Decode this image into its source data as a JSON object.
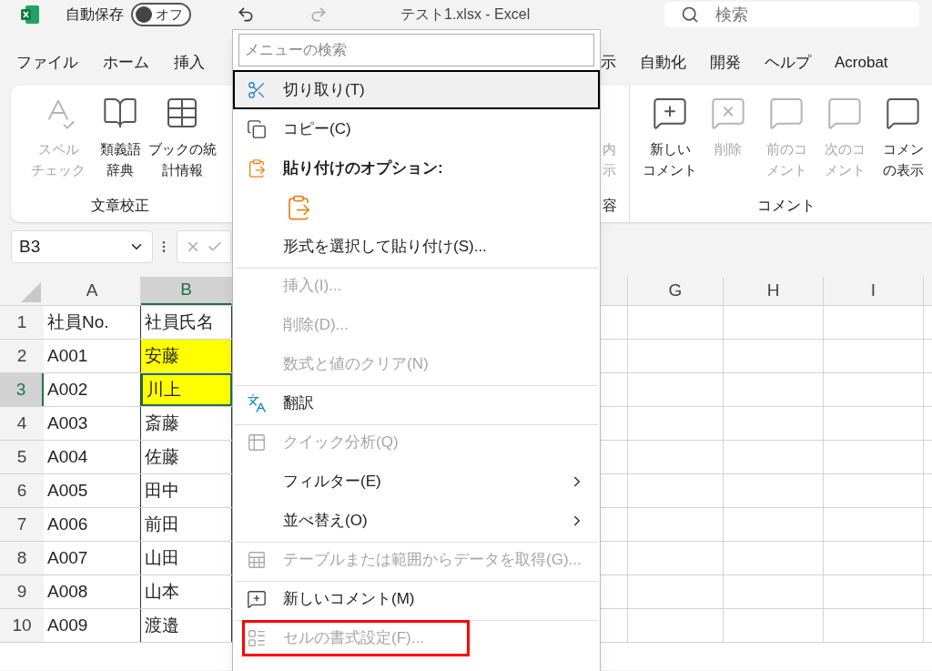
{
  "title_bar": {
    "autosave": {
      "label": "自動保存",
      "on": false,
      "state_label": "オフ"
    },
    "title": "テスト1.xlsx - Excel",
    "search": {
      "placeholder": "検索"
    }
  },
  "ribbon_tabs": {
    "left": [
      {
        "label": "ファイル"
      },
      {
        "label": "ホーム"
      },
      {
        "label": "挿入"
      }
    ],
    "right": [
      {
        "label": "示"
      },
      {
        "label": "自動化"
      },
      {
        "label": "開発"
      },
      {
        "label": "ヘルプ"
      },
      {
        "label": "Acrobat"
      }
    ]
  },
  "ribbon": {
    "left_groups": [
      {
        "label": "文章校正",
        "buttons": [
          {
            "lines": [
              "スペル",
              "チェック"
            ],
            "disabled": true
          },
          {
            "lines": [
              "類義語",
              "辞典"
            ],
            "disabled": false
          },
          {
            "lines": [
              "ブックの統",
              "計情報"
            ],
            "disabled": false
          }
        ]
      }
    ],
    "right_groups": [
      {
        "label": "容",
        "buttons": [
          {
            "lines": [
              "内",
              "示"
            ],
            "disabled": true
          }
        ]
      },
      {
        "label": "コメント",
        "buttons": [
          {
            "lines": [
              "新しい",
              "コメント"
            ],
            "disabled": false
          },
          {
            "lines": [
              "削除"
            ],
            "disabled": true
          },
          {
            "lines": [
              "前のコ",
              "メント"
            ],
            "disabled": true
          },
          {
            "lines": [
              "次のコ",
              "メント"
            ],
            "disabled": true
          },
          {
            "lines": [
              "コメン",
              "の表示"
            ],
            "disabled": false
          }
        ]
      }
    ]
  },
  "formula_bar": {
    "name_box": "B3"
  },
  "sheet": {
    "left_columns": [
      {
        "label": "A",
        "selected": false
      },
      {
        "label": "B",
        "selected": true
      }
    ],
    "right_columns": [
      {
        "label": "G",
        "selected": false
      },
      {
        "label": "H",
        "selected": false
      },
      {
        "label": "I",
        "selected": false
      }
    ],
    "rows": [
      {
        "number": "1",
        "selected": false,
        "cells": [
          {
            "value": "社員No.",
            "highlighted": false,
            "active": false
          },
          {
            "value": "社員氏名",
            "highlighted": false,
            "active": false
          }
        ]
      },
      {
        "number": "2",
        "selected": false,
        "cells": [
          {
            "value": "A001",
            "highlighted": false,
            "active": false
          },
          {
            "value": "安藤",
            "highlighted": true,
            "active": false
          }
        ]
      },
      {
        "number": "3",
        "selected": true,
        "cells": [
          {
            "value": "A002",
            "highlighted": false,
            "active": false
          },
          {
            "value": "川上",
            "highlighted": true,
            "active": true
          }
        ]
      },
      {
        "number": "4",
        "selected": false,
        "cells": [
          {
            "value": "A003",
            "highlighted": false,
            "active": false
          },
          {
            "value": "斎藤",
            "highlighted": false,
            "active": false
          }
        ]
      },
      {
        "number": "5",
        "selected": false,
        "cells": [
          {
            "value": "A004",
            "highlighted": false,
            "active": false
          },
          {
            "value": "佐藤",
            "highlighted": false,
            "active": false
          }
        ]
      },
      {
        "number": "6",
        "selected": false,
        "cells": [
          {
            "value": "A005",
            "highlighted": false,
            "active": false
          },
          {
            "value": "田中",
            "highlighted": false,
            "active": false
          }
        ]
      },
      {
        "number": "7",
        "selected": false,
        "cells": [
          {
            "value": "A006",
            "highlighted": false,
            "active": false
          },
          {
            "value": "前田",
            "highlighted": false,
            "active": false
          }
        ]
      },
      {
        "number": "8",
        "selected": false,
        "cells": [
          {
            "value": "A007",
            "highlighted": false,
            "active": false
          },
          {
            "value": "山田",
            "highlighted": false,
            "active": false
          }
        ]
      },
      {
        "number": "9",
        "selected": false,
        "cells": [
          {
            "value": "A008",
            "highlighted": false,
            "active": false
          },
          {
            "value": "山本",
            "highlighted": false,
            "active": false
          }
        ]
      },
      {
        "number": "10",
        "selected": false,
        "cells": [
          {
            "value": "A009",
            "highlighted": false,
            "active": false
          },
          {
            "value": "渡邉",
            "highlighted": false,
            "active": false
          }
        ]
      }
    ]
  },
  "context_menu": {
    "search": {
      "placeholder": "メニューの検索"
    },
    "items": [
      {
        "kind": "command",
        "label": "切り取り(T)",
        "disabled": false,
        "selected": true,
        "submenu": false,
        "separator_before": false,
        "annotated": false
      },
      {
        "kind": "command",
        "label": "コピー(C)",
        "disabled": false,
        "selected": false,
        "submenu": false,
        "separator_before": false,
        "annotated": false
      },
      {
        "kind": "heading",
        "label": "貼り付けのオプション:",
        "disabled": false,
        "selected": false,
        "submenu": false,
        "separator_before": false,
        "annotated": false
      },
      {
        "kind": "paste-options"
      },
      {
        "kind": "command",
        "label": "形式を選択して貼り付け(S)...",
        "disabled": false,
        "selected": false,
        "submenu": false,
        "separator_before": false,
        "annotated": false
      },
      {
        "kind": "command",
        "label": "挿入(I)...",
        "disabled": true,
        "selected": false,
        "submenu": false,
        "separator_before": true,
        "annotated": false
      },
      {
        "kind": "command",
        "label": "削除(D)...",
        "disabled": true,
        "selected": false,
        "submenu": false,
        "separator_before": false,
        "annotated": false
      },
      {
        "kind": "command",
        "label": "数式と値のクリア(N)",
        "disabled": true,
        "selected": false,
        "submenu": false,
        "separator_before": false,
        "annotated": false
      },
      {
        "kind": "command",
        "label": "翻訳",
        "disabled": false,
        "selected": false,
        "submenu": false,
        "separator_before": true,
        "annotated": false
      },
      {
        "kind": "command",
        "label": "クイック分析(Q)",
        "disabled": true,
        "selected": false,
        "submenu": false,
        "separator_before": true,
        "annotated": false
      },
      {
        "kind": "command",
        "label": "フィルター(E)",
        "disabled": false,
        "selected": false,
        "submenu": true,
        "separator_before": false,
        "annotated": false
      },
      {
        "kind": "command",
        "label": "並べ替え(O)",
        "disabled": false,
        "selected": false,
        "submenu": true,
        "separator_before": false,
        "annotated": false
      },
      {
        "kind": "command",
        "label": "テーブルまたは範囲からデータを取得(G)...",
        "disabled": true,
        "selected": false,
        "submenu": false,
        "separator_before": true,
        "annotated": false
      },
      {
        "kind": "command",
        "label": "新しいコメント(M)",
        "disabled": false,
        "selected": false,
        "submenu": false,
        "separator_before": true,
        "annotated": false
      },
      {
        "kind": "command",
        "label": "セルの書式設定(F)...",
        "disabled": true,
        "selected": false,
        "submenu": false,
        "separator_before": true,
        "annotated": true
      }
    ]
  }
}
